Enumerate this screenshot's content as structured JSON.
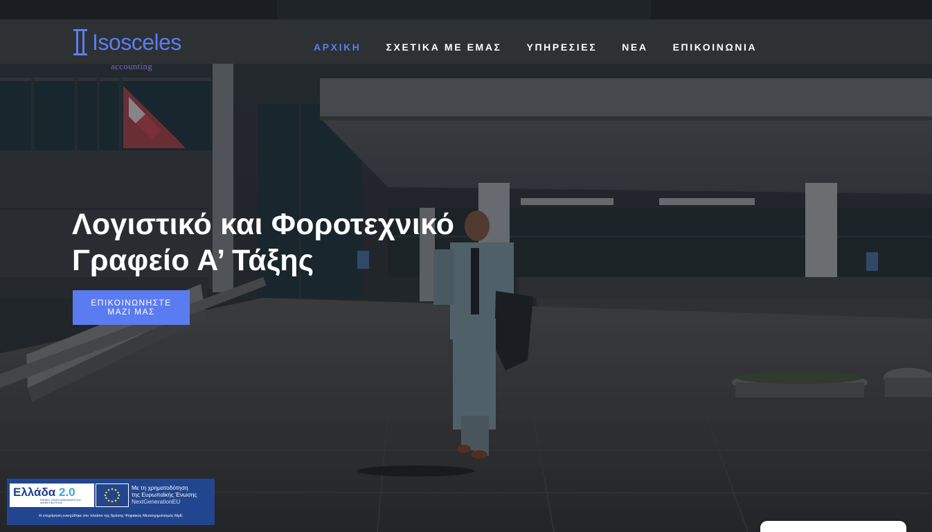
{
  "brand": {
    "name": "Isosceles",
    "tagline": "accounting",
    "color": "#5b7cf0",
    "tagline_color": "#7b62c9"
  },
  "nav": {
    "items": [
      {
        "label": "ΑΡΧΙΚΗ",
        "active": true
      },
      {
        "label": "ΣΧΕΤΙΚΑ ΜΕ ΕΜΑΣ",
        "active": false
      },
      {
        "label": "ΥΠΗΡΕΣΙΕΣ",
        "active": false
      },
      {
        "label": "ΝΕΑ",
        "active": false
      },
      {
        "label": "ΕΠΙΚΟΙΝΩΝΙΑ",
        "active": false
      }
    ]
  },
  "hero": {
    "title_line1": "Λογιστικό και Φοροτεχνικό",
    "title_line2": "Γραφείο Α’ Τάξης",
    "cta_label": "ΕΠΙΚΟΙΝΩΝΗΣΤΕ ΜΑΖΙ ΜΑΣ",
    "cta_color": "#5b7cf0",
    "background": "businessman-walking-photo"
  },
  "funding": {
    "greece_title": "Ελλάδα",
    "greece_version": "2.0",
    "greece_sub": "ΕΘΝΙΚΟ ΣΧΕΔΙΟ ΑΝΑΚΑΜΨΗΣ ΚΑΙ ΑΝΘΕΚΤΙΚΟΤΗΤΑΣ",
    "eu_line1": "Με τη χρηματοδότηση",
    "eu_line2": "της Ευρωπαϊκής Ένωσης",
    "eu_line3": "NextGenerationEU",
    "footer": "Η επιχείρηση ενισχύθηκε στο πλαίσιο της δράσης Ψηφιακός Μετασχηματισμός ΜμΕ",
    "background_color": "#21468f",
    "icon": "eu-flag-icon"
  }
}
